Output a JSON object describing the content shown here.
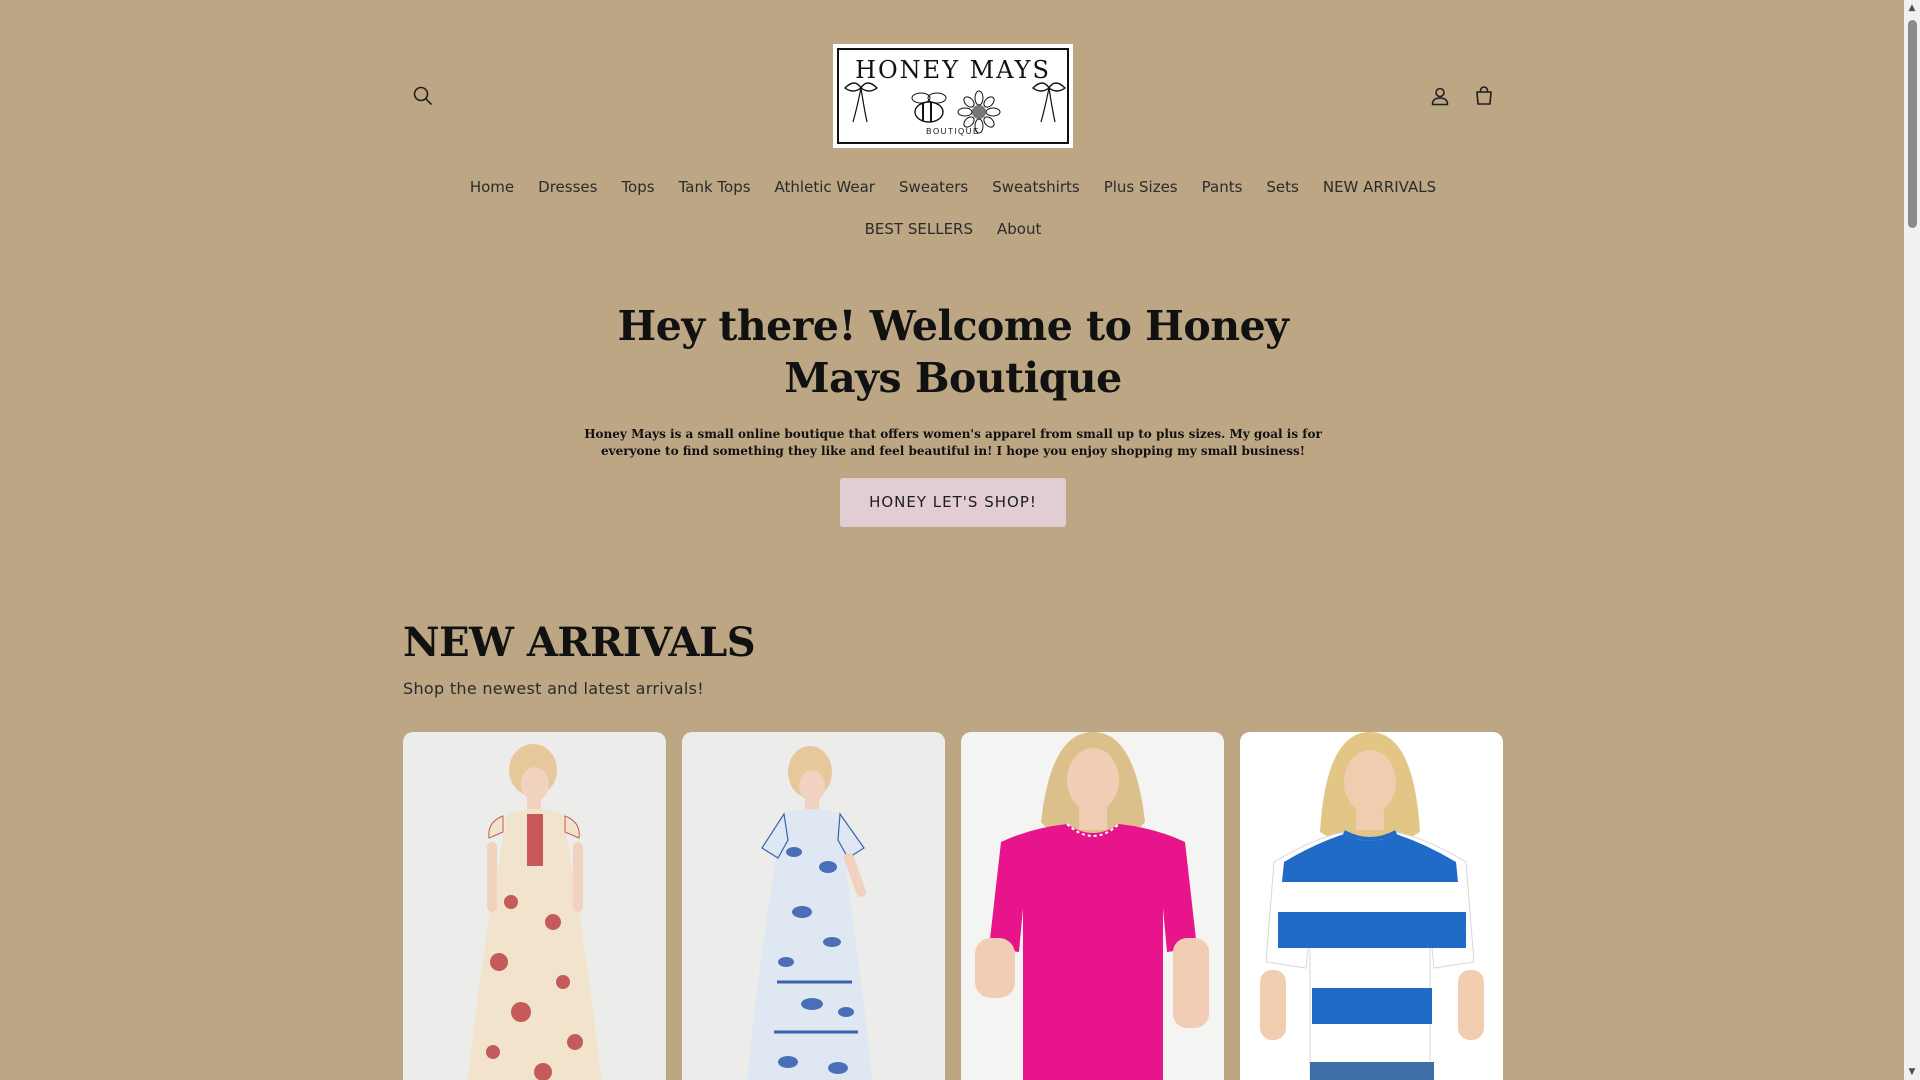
{
  "header": {
    "logo": {
      "wordmark": "HONEY MAYS",
      "subtitle": "BOUTIQUE"
    }
  },
  "nav": {
    "row1": [
      "Home",
      "Dresses",
      "Tops",
      "Tank Tops",
      "Athletic Wear",
      "Sweaters",
      "Sweatshirts",
      "Plus Sizes",
      "Pants",
      "Sets",
      "NEW ARRIVALS"
    ],
    "row2": [
      "BEST SELLERS",
      "About"
    ]
  },
  "hero": {
    "title": "Hey there! Welcome to Honey Mays Boutique",
    "text": "Honey Mays is a small online boutique that offers women's apparel from small up to plus sizes. My goal is for everyone to find something they like and feel beautiful in! I hope you enjoy shopping my small business!",
    "button_label": "HONEY LET'S SHOP!"
  },
  "arrivals": {
    "title": "NEW ARRIVALS",
    "subtitle": "Shop the newest and latest arrivals!"
  },
  "products": [
    {
      "image": "red floral ruffle maxi dress"
    },
    {
      "image": "blue paisley tiered maxi dress"
    },
    {
      "image": "hot pink stitched short sleeve top"
    },
    {
      "image": "blue and white striped tee"
    }
  ],
  "icons": {
    "search": "search-icon",
    "account": "account-icon",
    "cart": "cart-icon"
  },
  "colors": {
    "background": "#bca684",
    "button": "#e2cdd2",
    "text": "#111111"
  }
}
